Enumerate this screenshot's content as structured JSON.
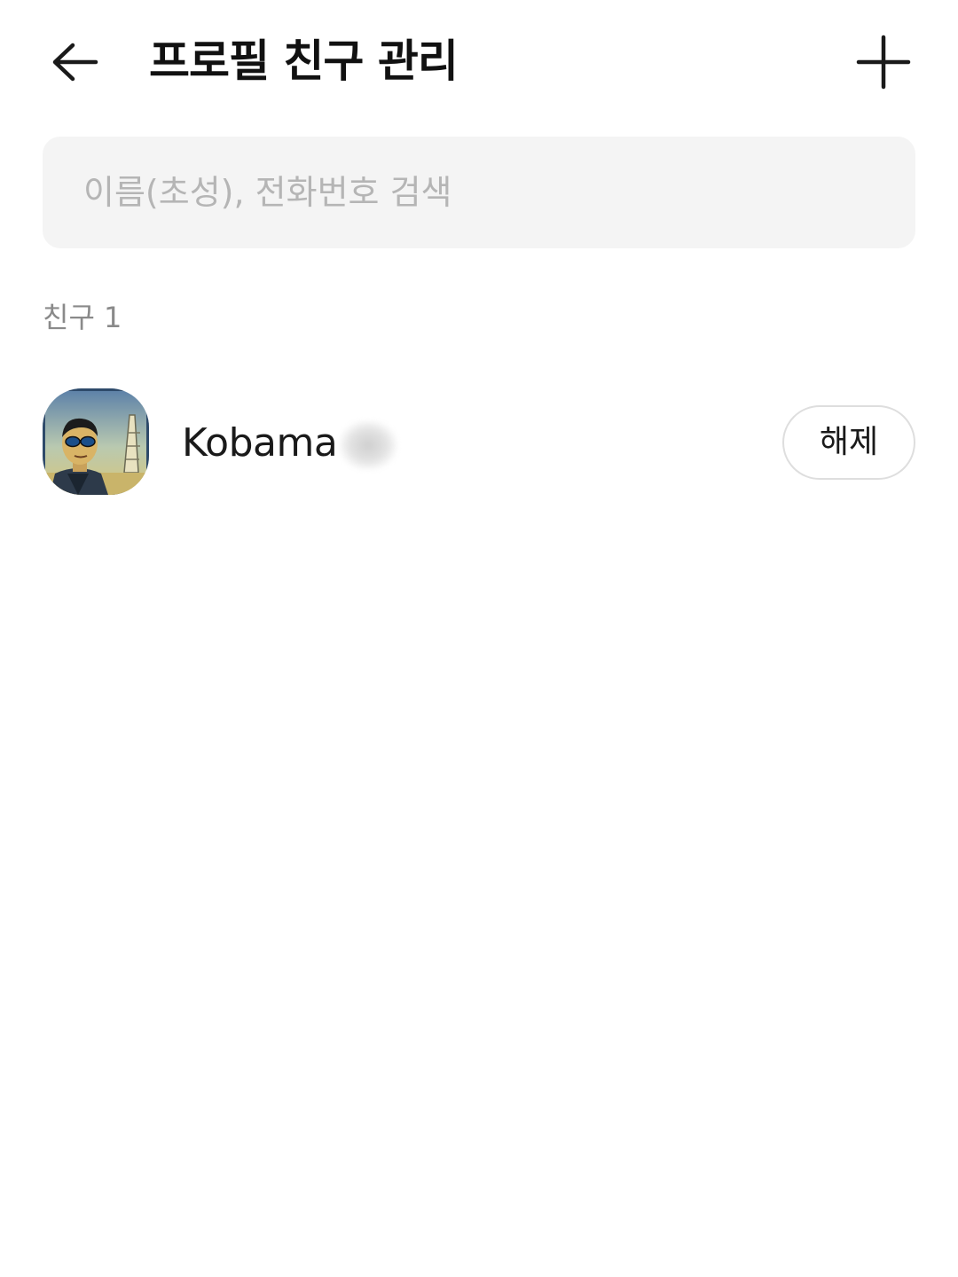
{
  "header": {
    "back_icon": "arrow-left-icon",
    "title": "프로필 친구 관리",
    "add_icon": "plus-icon"
  },
  "search": {
    "placeholder": "이름(초성), 전화번호 검색",
    "value": ""
  },
  "friends_section": {
    "label": "친구 1"
  },
  "friends": [
    {
      "name": "Kobama",
      "name_suffix_blurred": true,
      "avatar": "profile-photo-man-sunglasses",
      "action_label": "해제"
    }
  ],
  "colors": {
    "background": "#ffffff",
    "search_bg": "#f4f4f4",
    "placeholder": "#b5b5b5",
    "section_label": "#8a8a8a",
    "button_border": "#dedede",
    "text": "#1a1a1a"
  }
}
